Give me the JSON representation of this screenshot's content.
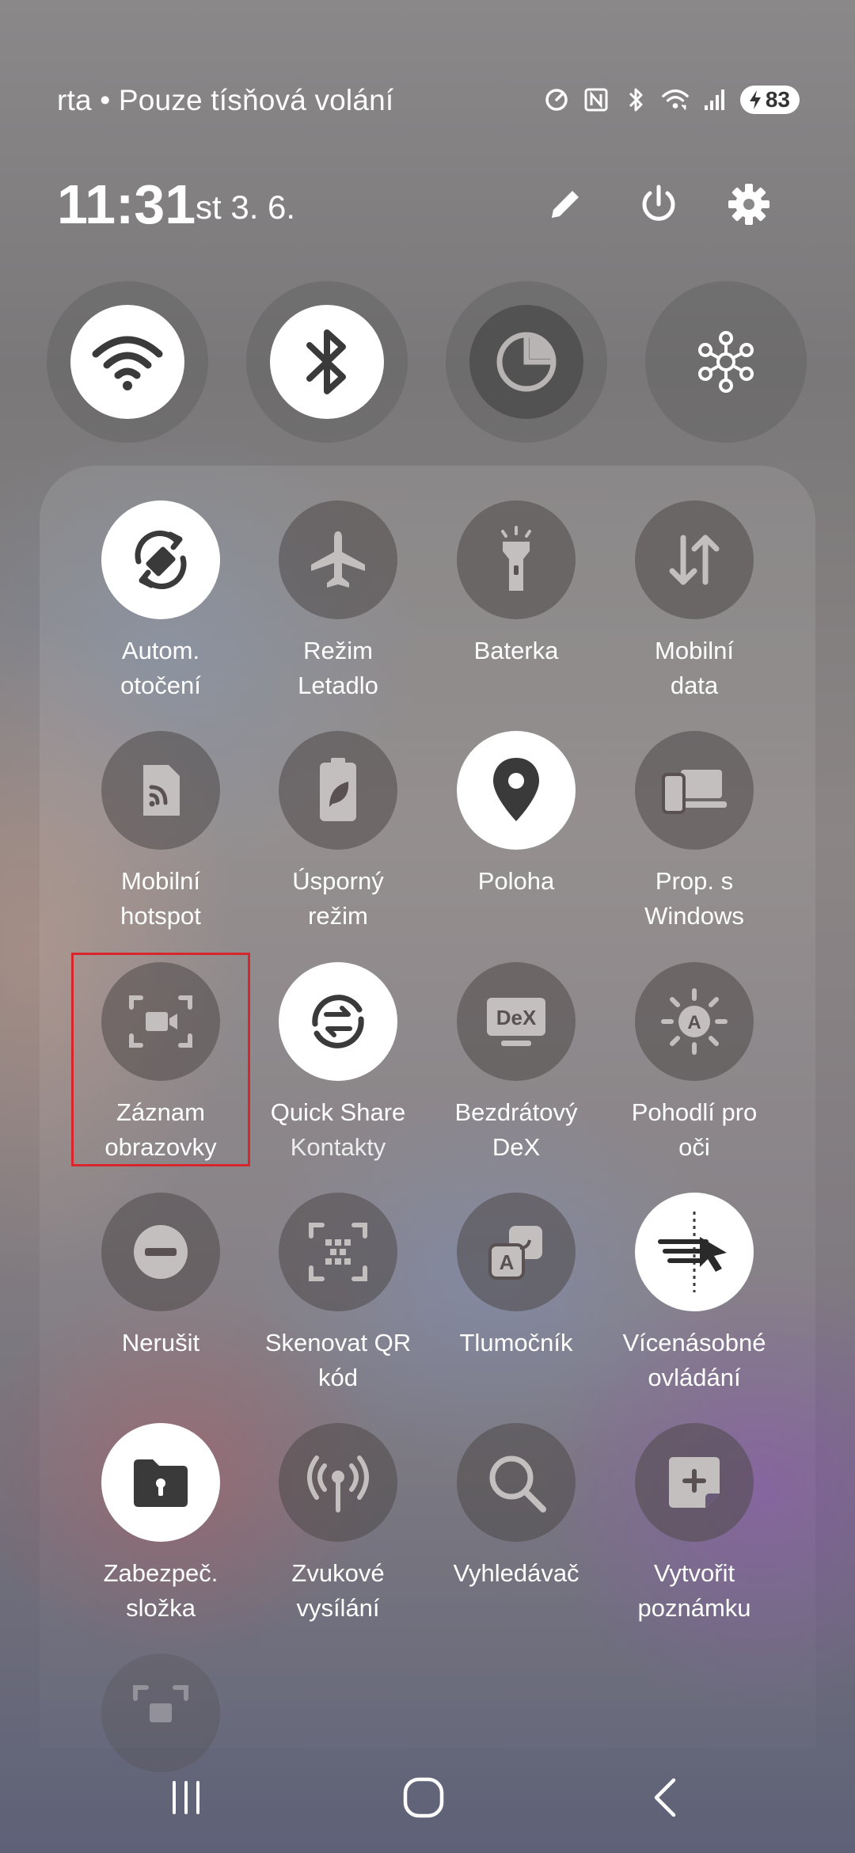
{
  "status_bar": {
    "carrier_text": "rta • Pouze tísňová volání",
    "battery_level": "83",
    "icons": [
      "data-saver-icon",
      "nfc-icon",
      "bluetooth-icon",
      "wifi-icon",
      "signal-icon",
      "battery-charging-icon"
    ]
  },
  "header": {
    "time": "11:31",
    "date": "st 3. 6.",
    "actions": [
      "edit-icon",
      "power-icon",
      "settings-icon"
    ]
  },
  "big_toggles": [
    {
      "name": "wifi",
      "icon": "wifi-icon",
      "state": "on"
    },
    {
      "name": "bluetooth",
      "icon": "bluetooth-icon",
      "state": "on"
    },
    {
      "name": "data-usage",
      "icon": "pie-chart-icon",
      "state": "off"
    },
    {
      "name": "connected-devices",
      "icon": "hub-icon",
      "state": "off"
    }
  ],
  "tiles": [
    {
      "line1": "Autom.",
      "line2": "otočení",
      "icon": "auto-rotate-icon",
      "state": "on"
    },
    {
      "line1": "Režim",
      "line2": "Letadlo",
      "icon": "airplane-icon",
      "state": "off"
    },
    {
      "line1": "Baterka",
      "line2": "",
      "icon": "flashlight-icon",
      "state": "off"
    },
    {
      "line1": "Mobilní",
      "line2": "data",
      "icon": "mobile-data-icon",
      "state": "off"
    },
    {
      "line1": "Mobilní",
      "line2": "hotspot",
      "icon": "hotspot-icon",
      "state": "off"
    },
    {
      "line1": "Úsporný",
      "line2": "režim",
      "icon": "power-saving-icon",
      "state": "off"
    },
    {
      "line1": "Poloha",
      "line2": "",
      "icon": "location-icon",
      "state": "on"
    },
    {
      "line1": "Prop. s",
      "line2": "Windows",
      "icon": "link-to-windows-icon",
      "state": "off"
    },
    {
      "line1": "Záznam",
      "line2": "obrazovky",
      "icon": "screen-recorder-icon",
      "state": "off"
    },
    {
      "line1": "Quick Share",
      "line2": "Kontakty",
      "icon": "quick-share-icon",
      "state": "on"
    },
    {
      "line1": "Bezdrátový",
      "line2": "DeX",
      "icon": "dex-icon",
      "state": "off",
      "badge": "DeX"
    },
    {
      "line1": "Pohodlí pro",
      "line2": "oči",
      "icon": "eye-comfort-icon",
      "state": "off",
      "badge": "A"
    },
    {
      "line1": "Nerušit",
      "line2": "",
      "icon": "do-not-disturb-icon",
      "state": "off"
    },
    {
      "line1": "Skenovat QR",
      "line2": "kód",
      "icon": "qr-scanner-icon",
      "state": "off"
    },
    {
      "line1": "Tlumočník",
      "line2": "",
      "icon": "interpreter-icon",
      "state": "off",
      "badge": "A"
    },
    {
      "line1": "Vícenásobné",
      "line2": "ovládání",
      "icon": "multi-control-icon",
      "state": "on"
    },
    {
      "line1": "Zabezpeč.",
      "line2": "složka",
      "icon": "secure-folder-icon",
      "state": "on"
    },
    {
      "line1": "Zvukové",
      "line2": "vysílání",
      "icon": "audio-broadcast-icon",
      "state": "off"
    },
    {
      "line1": "Vyhledávač",
      "line2": "",
      "icon": "search-icon",
      "state": "off"
    },
    {
      "line1": "Vytvořit",
      "line2": "poznámku",
      "icon": "create-note-icon",
      "state": "off"
    }
  ],
  "highlighted_tile": "Záznam obrazovky",
  "nav": [
    "recents-icon",
    "home-icon",
    "back-icon"
  ],
  "colors": {
    "highlight": "#d8262c",
    "tile_on": "#ffffff",
    "tile_off": "#4e4848"
  }
}
